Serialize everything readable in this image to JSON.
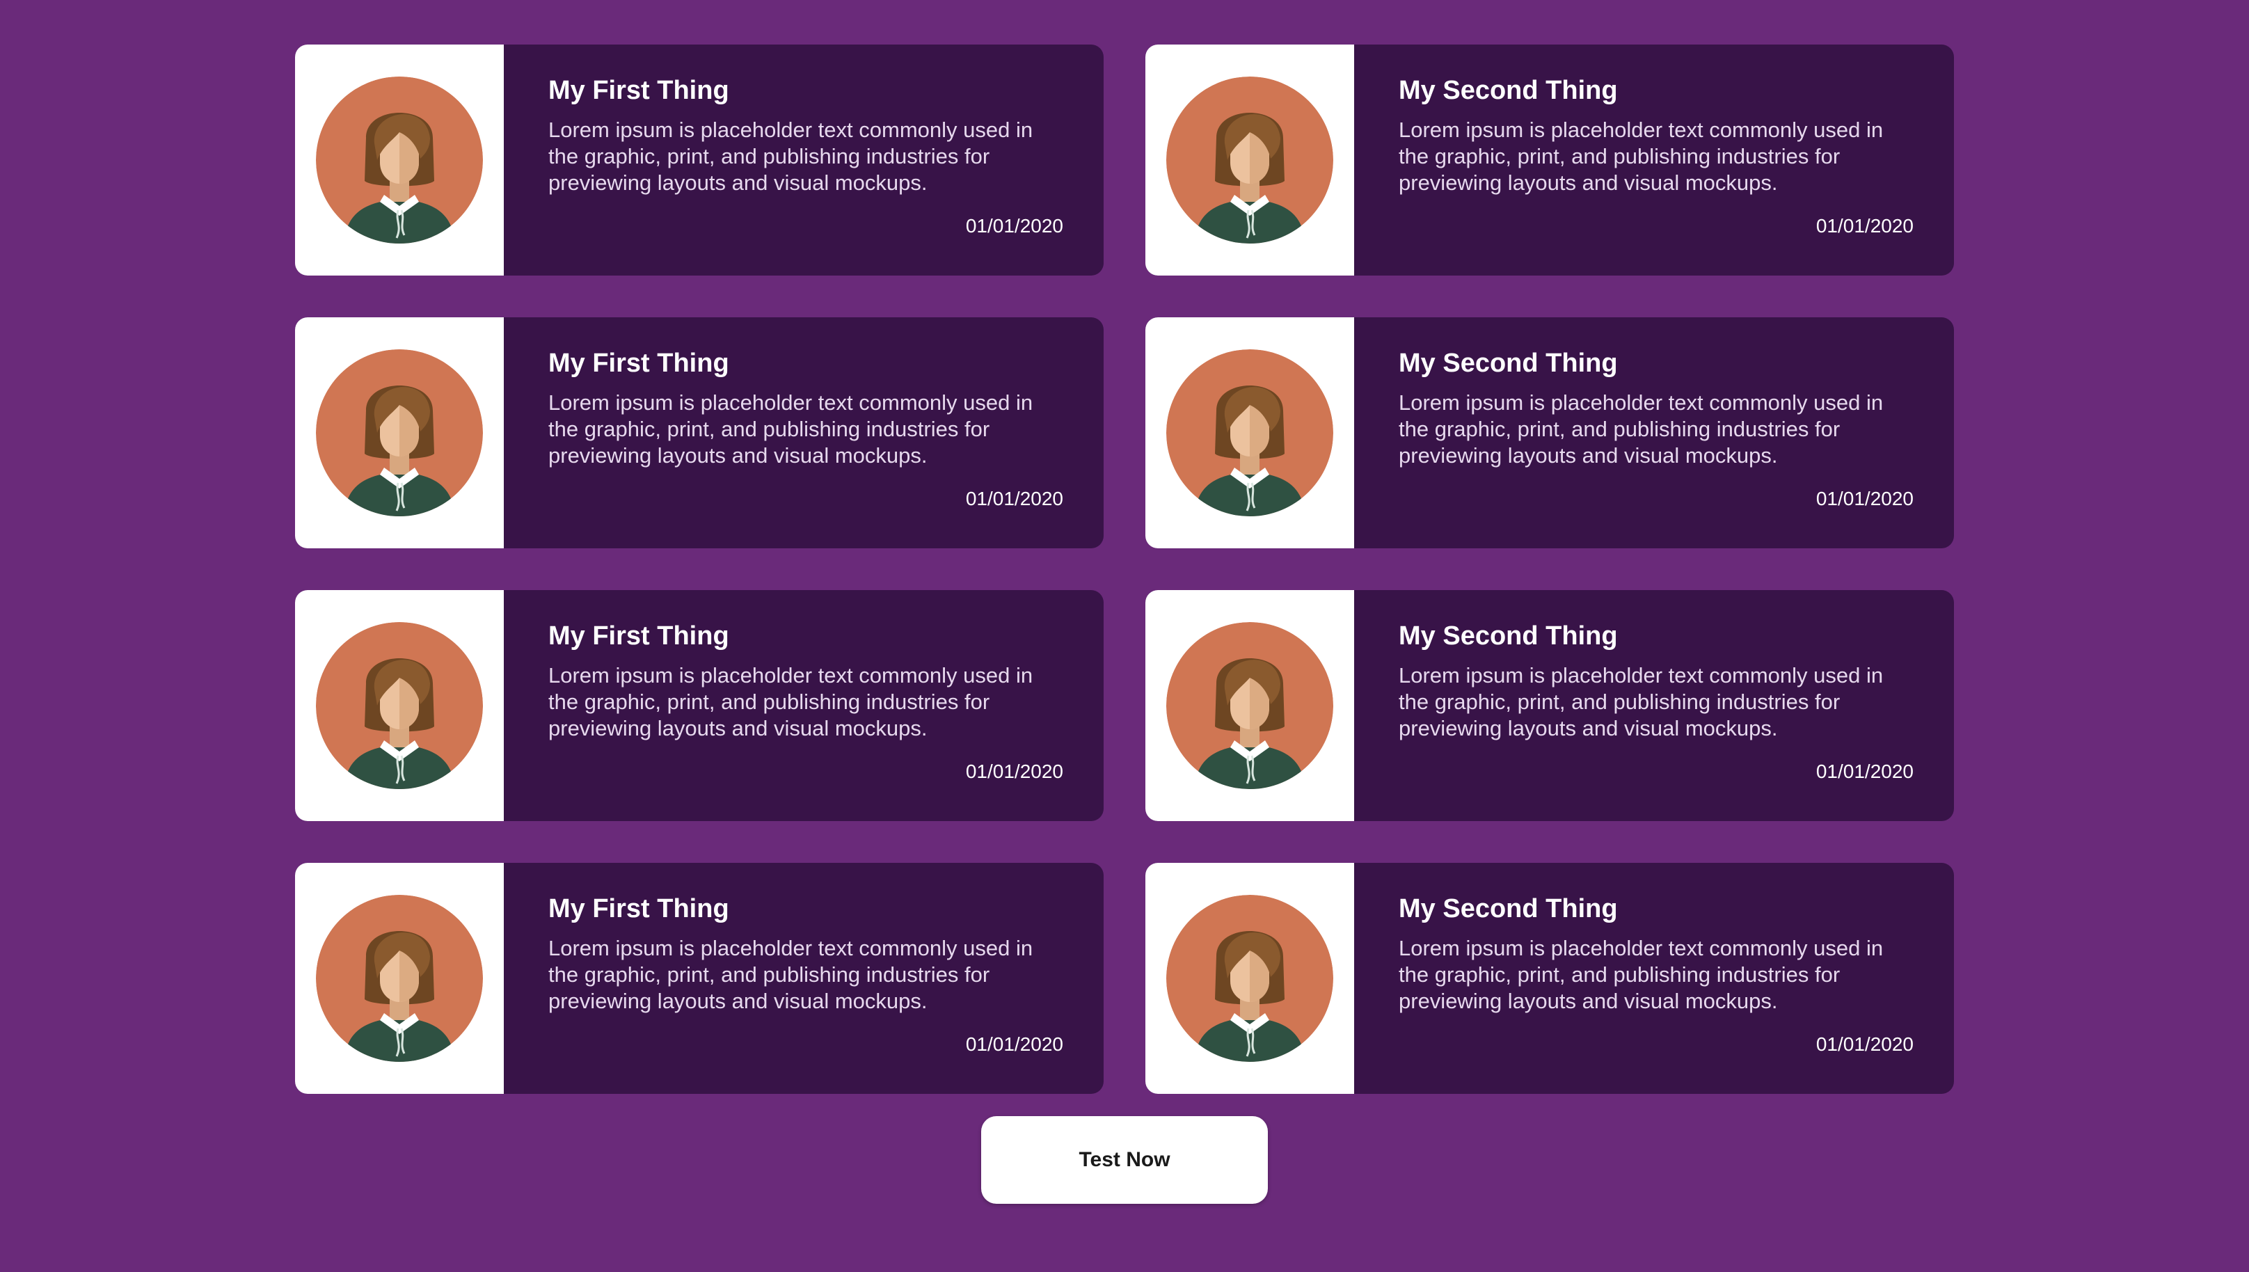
{
  "cards": [
    {
      "title": "My First Thing",
      "text": "Lorem ipsum is placeholder text commonly used in the graphic, print, and publishing industries for previewing layouts and visual mockups.",
      "date": "01/01/2020"
    },
    {
      "title": "My Second Thing",
      "text": "Lorem ipsum is placeholder text commonly used in the graphic, print, and publishing industries for previewing layouts and visual mockups.",
      "date": "01/01/2020"
    },
    {
      "title": "My First Thing",
      "text": "Lorem ipsum is placeholder text commonly used in the graphic, print, and publishing industries for previewing layouts and visual mockups.",
      "date": "01/01/2020"
    },
    {
      "title": "My Second Thing",
      "text": "Lorem ipsum is placeholder text commonly used in the graphic, print, and publishing industries for previewing layouts and visual mockups.",
      "date": "01/01/2020"
    },
    {
      "title": "My First Thing",
      "text": "Lorem ipsum is placeholder text commonly used in the graphic, print, and publishing industries for previewing layouts and visual mockups.",
      "date": "01/01/2020"
    },
    {
      "title": "My Second Thing",
      "text": "Lorem ipsum is placeholder text commonly used in the graphic, print, and publishing industries for previewing layouts and visual mockups.",
      "date": "01/01/2020"
    },
    {
      "title": "My First Thing",
      "text": "Lorem ipsum is placeholder text commonly used in the graphic, print, and publishing industries for previewing layouts and visual mockups.",
      "date": "01/01/2020"
    },
    {
      "title": "My Second Thing",
      "text": "Lorem ipsum is placeholder text commonly used in the graphic, print, and publishing industries for previewing layouts and visual mockups.",
      "date": "01/01/2020"
    }
  ],
  "avatar_icon": "user-avatar-icon",
  "button": {
    "label": "Test Now"
  },
  "colors": {
    "background": "#6a2a7a",
    "card": "#381348",
    "avatar_circle": "#d07653",
    "hair": "#8a5a2e",
    "skin": "#ecc29e",
    "shirt": "#2f5142"
  }
}
